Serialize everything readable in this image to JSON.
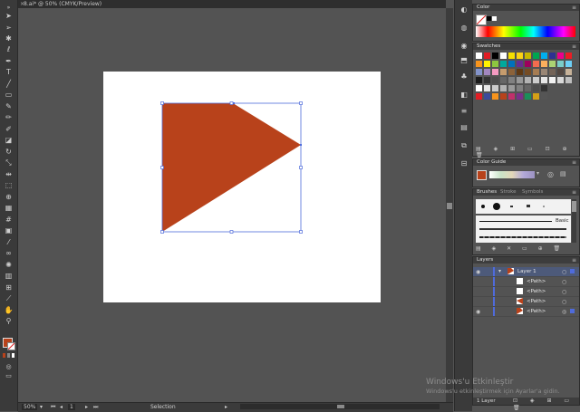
{
  "document": {
    "tab_label": "8.ai* @ 50% (CMYK/Preview)",
    "close_glyph": "×"
  },
  "status_bar": {
    "zoom": "50%",
    "artboard_number": "1",
    "tool_name": "Selection"
  },
  "shape": {
    "fill": "#b8421b",
    "selection_color": "#4f6bdb"
  },
  "panels": {
    "color": {
      "title": "Color",
      "menu": "≡"
    },
    "swatches": {
      "title": "Swatches",
      "menu": "≡"
    },
    "color_guide": {
      "title": "Color Guide",
      "menu": "≡"
    },
    "brushes": {
      "tabs": [
        "Brushes",
        "Stroke",
        "Symbols"
      ],
      "basic_label": "Basic",
      "menu": "≡"
    },
    "layers": {
      "title": "Layers",
      "menu": "≡",
      "rows": [
        {
          "name": "Layer 1",
          "kind": "layer"
        },
        {
          "name": "<Path>",
          "kind": "path"
        },
        {
          "name": "<Path>",
          "kind": "path"
        },
        {
          "name": "<Path>",
          "kind": "path"
        },
        {
          "name": "<Path>",
          "kind": "path"
        }
      ],
      "footer": "1 Layer"
    }
  },
  "watermark": {
    "line1": "Windows'u Etkinleştir",
    "line2": "Windows'u etkinleştirmek için Ayarlar'a gidin."
  },
  "colors": {
    "fill_swatch": "#b8421b",
    "accent": "#b8421b"
  },
  "tools": [
    "selection-tool",
    "direct-selection-tool",
    "magic-wand-tool",
    "lasso-tool",
    "pen-tool",
    "type-tool",
    "line-tool",
    "rectangle-tool",
    "paintbrush-tool",
    "pencil-tool",
    "blob-brush-tool",
    "eraser-tool",
    "rotate-tool",
    "scale-tool",
    "width-tool",
    "free-transform-tool",
    "shape-builder-tool",
    "perspective-grid-tool",
    "mesh-tool",
    "gradient-tool",
    "eyedropper-tool",
    "blend-tool",
    "symbol-sprayer-tool",
    "column-graph-tool",
    "artboard-tool",
    "slice-tool",
    "hand-tool",
    "zoom-tool"
  ]
}
